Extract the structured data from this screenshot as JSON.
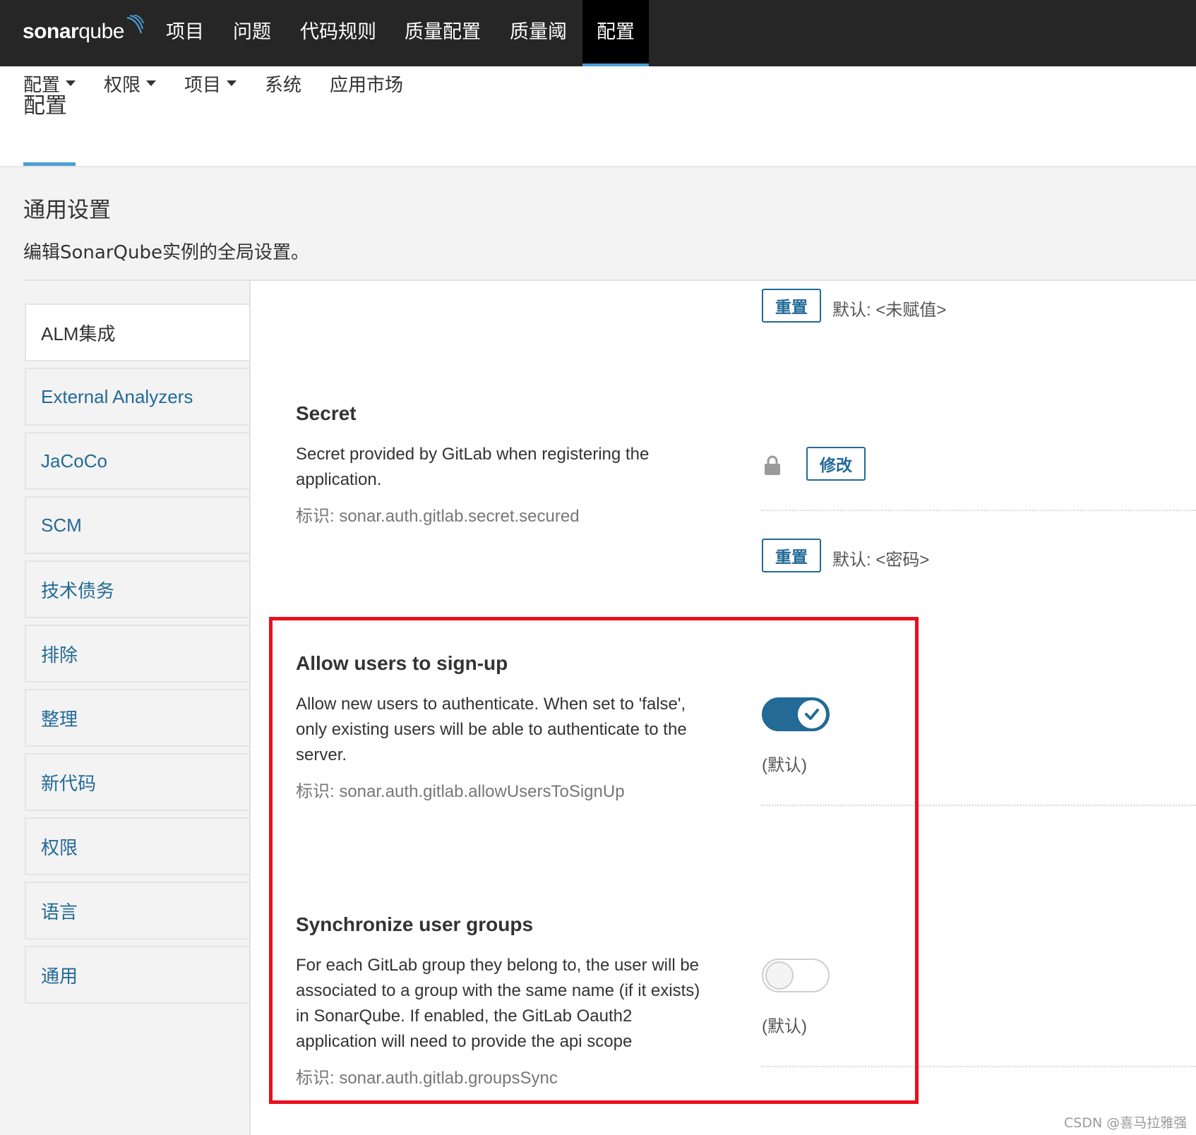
{
  "topnav": {
    "logo_bold": "sonar",
    "logo_light": "qube",
    "items": [
      "项目",
      "问题",
      "代码规则",
      "质量配置",
      "质量阈",
      "配置"
    ]
  },
  "header": {
    "title": "配置",
    "subnav": [
      "配置",
      "权限",
      "项目",
      "系统",
      "应用市场"
    ]
  },
  "section": {
    "title": "通用设置",
    "description": "编辑SonarQube实例的全局设置。"
  },
  "sidebar": {
    "items": [
      "ALM集成",
      "External Analyzers",
      "JaCoCo",
      "SCM",
      "技术债务",
      "排除",
      "整理",
      "新代码",
      "权限",
      "语言",
      "通用"
    ]
  },
  "settings": {
    "top": {
      "reset_label": "重置",
      "default_text": "默认: <未赋值>"
    },
    "secret": {
      "title": "Secret",
      "desc_line1": "Secret provided by GitLab when registering the",
      "desc_line2": "application.",
      "key": "标识: sonar.auth.gitlab.secret.secured",
      "change_label": "修改",
      "reset_label": "重置",
      "default_text": "默认: <密码>"
    },
    "signup": {
      "title": "Allow users to sign-up",
      "desc_line1": "Allow new users to authenticate. When set to 'false',",
      "desc_line2": "only existing users will be able to authenticate to the",
      "desc_line3": "server.",
      "key": "标识: sonar.auth.gitlab.allowUsersToSignUp",
      "enabled": true,
      "default_label": "(默认)"
    },
    "groups": {
      "title": "Synchronize user groups",
      "desc_line1": "For each GitLab group they belong to, the user will be",
      "desc_line2": "associated to a group with the same name (if it exists)",
      "desc_line3": "in SonarQube. If enabled, the GitLab Oauth2",
      "desc_line4": "application will need to provide the api scope",
      "key": "标识: sonar.auth.gitlab.groupsSync",
      "enabled": false,
      "default_label": "(默认)"
    }
  },
  "watermark": "CSDN @喜马拉雅强",
  "colors": {
    "nav_bg": "#262626",
    "accent": "#236a97",
    "active_underline": "#4b9fd5",
    "highlight_border": "#e8101d"
  }
}
